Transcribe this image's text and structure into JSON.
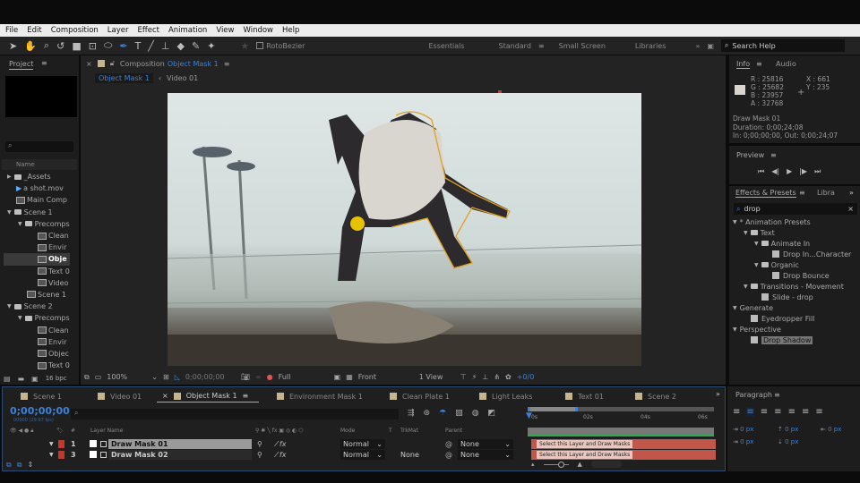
{
  "menu": [
    "File",
    "Edit",
    "Composition",
    "Layer",
    "Effect",
    "Animation",
    "View",
    "Window",
    "Help"
  ],
  "toolbar": {
    "rotobezier": "RotoBezier",
    "workspaces": [
      "Essentials",
      "Standard",
      "Small Screen",
      "Libraries"
    ],
    "active_workspace": "Standard",
    "search_help": "Search Help"
  },
  "project": {
    "tab": "Project",
    "search_placeholder": "",
    "col_name": "Name",
    "bpc": "16 bpc",
    "items": [
      {
        "label": "_Assets",
        "type": "folder",
        "indent": 0,
        "twirl": "closed"
      },
      {
        "label": "a shot.mov",
        "type": "footage",
        "indent": 0
      },
      {
        "label": "Main Comp",
        "type": "comp",
        "indent": 0
      },
      {
        "label": "Scene 1",
        "type": "folder",
        "indent": 0,
        "twirl": "open"
      },
      {
        "label": "Precomps",
        "type": "folder",
        "indent": 1,
        "twirl": "open"
      },
      {
        "label": "Clean",
        "type": "comp",
        "indent": 2
      },
      {
        "label": "Envir",
        "type": "comp",
        "indent": 2
      },
      {
        "label": "Obje",
        "type": "comp",
        "indent": 2,
        "selected": true
      },
      {
        "label": "Text 0",
        "type": "comp",
        "indent": 2
      },
      {
        "label": "Video",
        "type": "comp",
        "indent": 2
      },
      {
        "label": "Scene 1",
        "type": "comp",
        "indent": 1
      },
      {
        "label": "Scene 2",
        "type": "folder",
        "indent": 0,
        "twirl": "open"
      },
      {
        "label": "Precomps",
        "type": "folder",
        "indent": 1,
        "twirl": "open"
      },
      {
        "label": "Clean",
        "type": "comp",
        "indent": 2
      },
      {
        "label": "Envir",
        "type": "comp",
        "indent": 2
      },
      {
        "label": "Objec",
        "type": "comp",
        "indent": 2
      },
      {
        "label": "Text 0",
        "type": "comp",
        "indent": 2
      }
    ]
  },
  "composition": {
    "panel_label": "Composition",
    "comp_name": "Object Mask 1",
    "breadcrumbs": [
      "Object Mask 1",
      "Video 01"
    ],
    "viewer": {
      "zoom": "100%",
      "timecode": "0;00;00;00",
      "resolution": "Full",
      "view": "Front",
      "views": "1 View",
      "exposure": "+0/0"
    }
  },
  "info": {
    "tab": "Info",
    "tab2": "Audio",
    "r": "R : 25816",
    "g": "G : 25682",
    "b": "B : 23957",
    "a": "A : 32768",
    "x": "X : 661",
    "y": "Y : 235",
    "layer": "Draw Mask 01",
    "duration": "Duration: 0;00;24;08",
    "inout": "In: 0;00;00;00, Out: 0;00;24;07"
  },
  "preview": {
    "tab": "Preview"
  },
  "effects": {
    "tab": "Effects & Presets",
    "tab2": "Libra",
    "search": "drop",
    "items": [
      {
        "label": "* Animation Presets",
        "indent": 0,
        "kind": "cat"
      },
      {
        "label": "Text",
        "indent": 1,
        "kind": "folder"
      },
      {
        "label": "Animate In",
        "indent": 2,
        "kind": "folder"
      },
      {
        "label": "Drop In...Character",
        "indent": 3,
        "kind": "preset"
      },
      {
        "label": "Organic",
        "indent": 2,
        "kind": "folder"
      },
      {
        "label": "Drop Bounce",
        "indent": 3,
        "kind": "preset"
      },
      {
        "label": "Transitions - Movement",
        "indent": 1,
        "kind": "folder"
      },
      {
        "label": "Slide - drop",
        "indent": 2,
        "kind": "preset"
      },
      {
        "label": "Generate",
        "indent": 0,
        "kind": "cat"
      },
      {
        "label": "Eyedropper Fill",
        "indent": 1,
        "kind": "effect"
      },
      {
        "label": "Perspective",
        "indent": 0,
        "kind": "cat"
      },
      {
        "label": "Drop Shadow",
        "indent": 1,
        "kind": "effect",
        "selected": true
      }
    ]
  },
  "timeline": {
    "tabs": [
      "Scene 1",
      "Video 01",
      "Object Mask 1",
      "Environment Mask 1",
      "Clean Plate 1",
      "Light Leaks",
      "Text 01",
      "Scene 2"
    ],
    "active_tab": "Object Mask 1",
    "timecode": "0;00;00;00",
    "fps": "00000 (29.97 fps)",
    "columns": {
      "num": "#",
      "layer_name": "Layer Name",
      "mode": "Mode",
      "t": "T",
      "trkmat": "TrkMat",
      "parent": "Parent"
    },
    "ruler": [
      "0s",
      "02s",
      "04s",
      "06s"
    ],
    "layers": [
      {
        "num": "1",
        "name": "Draw Mask 01",
        "mode": "Normal",
        "trkmat": "",
        "parent": "None",
        "bar_label": "Select this Layer and Draw Masks",
        "selected": true
      },
      {
        "num": "3",
        "name": "Draw Mask 02",
        "mode": "Normal",
        "trkmat": "None",
        "parent": "None",
        "bar_label": "Select this Layer and Draw Masks"
      }
    ]
  },
  "paragraph": {
    "tab": "Paragraph",
    "fields": [
      "0 px",
      "0 px",
      "0 px",
      "0 px",
      "0 px"
    ]
  },
  "colors": {
    "accent": "#3b82d8",
    "label_red": "#c0392b",
    "bar_red": "#c0574a",
    "mask_path": "#e0a020"
  }
}
